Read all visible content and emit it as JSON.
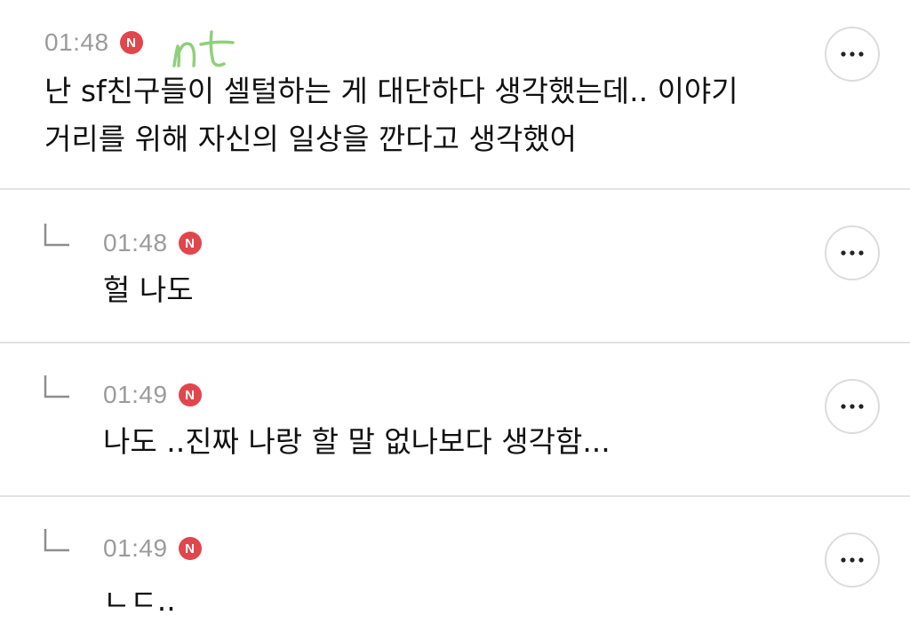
{
  "colors": {
    "badge": "#e0464c",
    "timestamp": "#9b9b9b",
    "text": "#111111",
    "divider": "#e3e3e3",
    "handwriting": "#8fd07a"
  },
  "icons": {
    "reply": "reply-indent-icon",
    "more": "more-horizontal-icon",
    "badge": "new-badge-icon"
  },
  "handwritten_note": "nt",
  "comments": [
    {
      "time": "01:48",
      "badge": "N",
      "lines": [
        "난 sf친구들이 셀털하는 게 대단하다 생각했는데.. 이야기",
        "거리를 위해 자신의 일상을 깐다고 생각했어"
      ]
    },
    {
      "time": "01:48",
      "badge": "N",
      "lines": [
        "헐 나도"
      ]
    },
    {
      "time": "01:49",
      "badge": "N",
      "lines": [
        "나도 ..진짜 나랑 할 말 없나보다 생각함..."
      ]
    },
    {
      "time": "01:49",
      "badge": "N",
      "lines": [
        "ㄴㄷ.."
      ]
    }
  ]
}
